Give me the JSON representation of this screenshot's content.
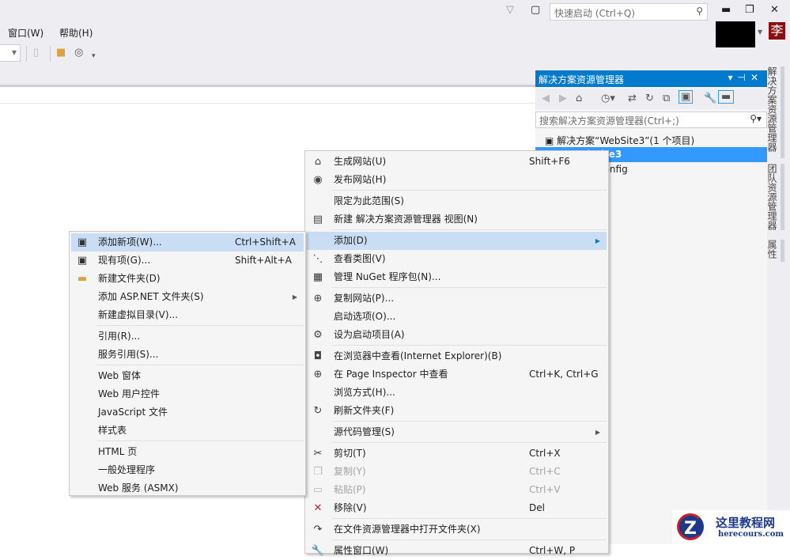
{
  "menubar": {
    "items": [
      "窗口(W)",
      "帮助(H)"
    ]
  },
  "titlebar": {
    "quick_launch_placeholder": "快速启动 (Ctrl+Q)",
    "avatar_char": "李"
  },
  "solution_explorer": {
    "title": "解决方案资源管理器",
    "search_placeholder": "搜索解决方案资源管理器(Ctrl+;)",
    "tree": [
      {
        "label": "解决方案“WebSite3”(1 个项目)",
        "selected": false
      },
      {
        "label": "WebSite3",
        "selected": true
      },
      {
        "label": "Web.config",
        "selected": false
      }
    ]
  },
  "side_tabs": [
    "解决方案资源管理器",
    "团队资源管理器",
    "属性"
  ],
  "context_menu": {
    "items": [
      {
        "label": "生成网站(U)",
        "shortcut": "Shift+F6",
        "icon": "build-icon"
      },
      {
        "label": "发布网站(H)",
        "icon": "publish-icon"
      },
      {
        "sep": true
      },
      {
        "label": "限定为此范围(S)"
      },
      {
        "label": "新建 解决方案资源管理器 视图(N)",
        "icon": "new-view-icon"
      },
      {
        "sep": true
      },
      {
        "label": "添加(D)",
        "submenu": true,
        "highlighted": true
      },
      {
        "label": "查看类图(V)",
        "icon": "class-diagram-icon"
      },
      {
        "label": "管理 NuGet 程序包(N)...",
        "icon": "nuget-icon"
      },
      {
        "sep": true
      },
      {
        "label": "复制网站(P)...",
        "icon": "copy-website-icon"
      },
      {
        "label": "启动选项(O)..."
      },
      {
        "label": "设为启动项目(A)",
        "icon": "gear-icon"
      },
      {
        "sep": true
      },
      {
        "label": "在浏览器中查看(Internet Explorer)(B)",
        "icon": "browser-icon"
      },
      {
        "label": "在 Page Inspector 中查看",
        "shortcut": "Ctrl+K, Ctrl+G",
        "icon": "page-inspector-icon"
      },
      {
        "label": "浏览方式(H)..."
      },
      {
        "label": "刷新文件夹(F)",
        "icon": "refresh-icon"
      },
      {
        "sep": true
      },
      {
        "label": "源代码管理(S)",
        "submenu": true
      },
      {
        "sep": true
      },
      {
        "label": "剪切(T)",
        "shortcut": "Ctrl+X",
        "icon": "cut-icon"
      },
      {
        "label": "复制(Y)",
        "shortcut": "Ctrl+C",
        "icon": "copy-icon",
        "disabled": true
      },
      {
        "label": "粘贴(P)",
        "shortcut": "Ctrl+V",
        "icon": "paste-icon",
        "disabled": true
      },
      {
        "label": "移除(V)",
        "shortcut": "Del",
        "icon": "remove-icon"
      },
      {
        "sep": true
      },
      {
        "label": "在文件资源管理器中打开文件夹(X)",
        "icon": "open-folder-icon"
      },
      {
        "sep": true
      },
      {
        "label": "属性窗口(W)",
        "shortcut": "Ctrl+W, P",
        "icon": "wrench-icon"
      }
    ]
  },
  "add_submenu": {
    "items": [
      {
        "label": "添加新项(W)...",
        "shortcut": "Ctrl+Shift+A",
        "icon": "add-new-item-icon",
        "highlighted": true
      },
      {
        "label": "现有项(G)...",
        "shortcut": "Shift+Alt+A",
        "icon": "add-existing-item-icon"
      },
      {
        "label": "新建文件夹(D)",
        "icon": "new-folder-icon"
      },
      {
        "label": "添加 ASP.NET 文件夹(S)",
        "submenu": true
      },
      {
        "label": "新建虚拟目录(V)..."
      },
      {
        "sep": true
      },
      {
        "label": "引用(R)..."
      },
      {
        "label": "服务引用(S)..."
      },
      {
        "sep": true
      },
      {
        "label": "Web 窗体"
      },
      {
        "label": "Web 用户控件"
      },
      {
        "label": "JavaScript 文件"
      },
      {
        "label": "样式表"
      },
      {
        "sep": true
      },
      {
        "label": "HTML 页"
      },
      {
        "label": "一般处理程序"
      },
      {
        "label": "Web 服务 (ASMX)"
      }
    ]
  },
  "watermark": {
    "title": "这里教程网",
    "url": "herecours.com"
  },
  "colors": {
    "accent": "#007acc",
    "selection": "#3399ff",
    "highlight": "#c9def5",
    "remove": "#c8202a"
  }
}
